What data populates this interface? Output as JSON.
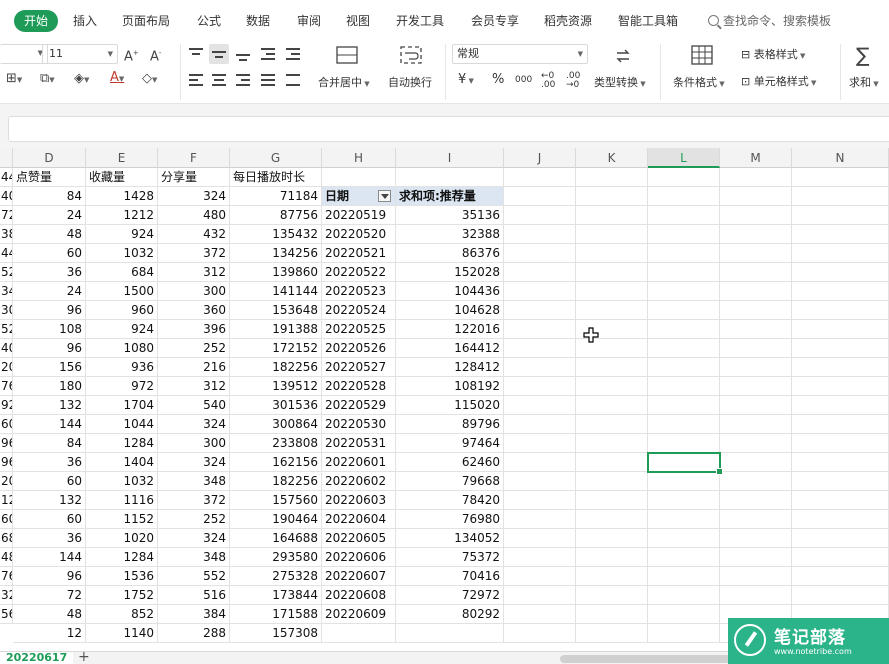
{
  "menu": {
    "tabs": [
      "开始",
      "插入",
      "页面布局",
      "公式",
      "数据",
      "审阅",
      "视图",
      "开发工具",
      "会员专享",
      "稻壳资源",
      "智能工具箱"
    ],
    "active_tab": "开始",
    "search_placeholder": "查找命令、搜索模板"
  },
  "toolbar": {
    "font_size": "11",
    "merge_center": "合并居中",
    "wrap_text": "自动换行",
    "number_format": "常规",
    "currency_symbol": "¥",
    "percent_symbol": "%",
    "thousands_symbol": "000",
    "type_convert": "类型转换",
    "conditional_format": "条件格式",
    "table_style": "表格样式",
    "cell_style": "单元格样式",
    "sum": "求和"
  },
  "columns": [
    "D",
    "E",
    "F",
    "G",
    "H",
    "I",
    "J",
    "K",
    "L",
    "M",
    "N"
  ],
  "selected_column": "L",
  "headers": {
    "D": "点赞量",
    "E": "收藏量",
    "F": "分享量",
    "G": "每日播放时长"
  },
  "pivot": {
    "date_header": "日期",
    "value_header": "求和项:推荐量"
  },
  "left_clip": [
    "44",
    "40",
    "72",
    "38",
    "44",
    "52",
    "34",
    "30",
    "52",
    "40",
    "20",
    "76",
    "92",
    "60",
    "96",
    "96",
    "20",
    "12",
    "60",
    "68",
    "48",
    "76",
    "32",
    "56"
  ],
  "rows": [
    {
      "d": "84",
      "e": "1428",
      "f": "324",
      "g": "71184",
      "h": "",
      "i": ""
    },
    {
      "d": "24",
      "e": "1212",
      "f": "480",
      "g": "87756",
      "h": "",
      "i": ""
    },
    {
      "d": "48",
      "e": "924",
      "f": "432",
      "g": "135432",
      "h": "20220519",
      "i": "35136"
    },
    {
      "d": "60",
      "e": "1032",
      "f": "372",
      "g": "134256",
      "h": "20220520",
      "i": "32388"
    },
    {
      "d": "36",
      "e": "684",
      "f": "312",
      "g": "139860",
      "h": "20220521",
      "i": "86376"
    },
    {
      "d": "24",
      "e": "1500",
      "f": "300",
      "g": "141144",
      "h": "20220522",
      "i": "152028"
    },
    {
      "d": "96",
      "e": "960",
      "f": "360",
      "g": "153648",
      "h": "20220523",
      "i": "104436"
    },
    {
      "d": "108",
      "e": "924",
      "f": "396",
      "g": "191388",
      "h": "20220524",
      "i": "104628"
    },
    {
      "d": "96",
      "e": "1080",
      "f": "252",
      "g": "172152",
      "h": "20220525",
      "i": "122016"
    },
    {
      "d": "156",
      "e": "936",
      "f": "216",
      "g": "182256",
      "h": "20220526",
      "i": "164412"
    },
    {
      "d": "180",
      "e": "972",
      "f": "312",
      "g": "139512",
      "h": "20220527",
      "i": "128412"
    },
    {
      "d": "132",
      "e": "1704",
      "f": "540",
      "g": "301536",
      "h": "20220528",
      "i": "108192"
    },
    {
      "d": "144",
      "e": "1044",
      "f": "324",
      "g": "300864",
      "h": "20220529",
      "i": "115020"
    },
    {
      "d": "84",
      "e": "1284",
      "f": "300",
      "g": "233808",
      "h": "20220530",
      "i": "89796"
    },
    {
      "d": "36",
      "e": "1404",
      "f": "324",
      "g": "162156",
      "h": "20220531",
      "i": "97464"
    },
    {
      "d": "60",
      "e": "1032",
      "f": "348",
      "g": "182256",
      "h": "20220601",
      "i": "62460"
    },
    {
      "d": "132",
      "e": "1116",
      "f": "372",
      "g": "157560",
      "h": "20220602",
      "i": "79668"
    },
    {
      "d": "60",
      "e": "1152",
      "f": "252",
      "g": "190464",
      "h": "20220603",
      "i": "78420"
    },
    {
      "d": "36",
      "e": "1020",
      "f": "324",
      "g": "164688",
      "h": "20220604",
      "i": "76980"
    },
    {
      "d": "144",
      "e": "1284",
      "f": "348",
      "g": "293580",
      "h": "20220605",
      "i": "134052"
    },
    {
      "d": "96",
      "e": "1536",
      "f": "552",
      "g": "275328",
      "h": "20220606",
      "i": "75372"
    },
    {
      "d": "72",
      "e": "1752",
      "f": "516",
      "g": "173844",
      "h": "20220607",
      "i": "70416"
    },
    {
      "d": "48",
      "e": "852",
      "f": "384",
      "g": "171588",
      "h": "20220608",
      "i": "72972"
    },
    {
      "d": "12",
      "e": "1140",
      "f": "288",
      "g": "157308",
      "h": "20220609",
      "i": "80292"
    }
  ],
  "sheet": {
    "name": "20220617",
    "add_symbol": "+"
  },
  "watermark": {
    "title": "笔记部落",
    "url": "www.notetribe.com"
  },
  "colors": {
    "accent": "#1e9b57",
    "pivot_header_bg": "#dce6f2",
    "watermark_bg": "#2bb38a"
  }
}
